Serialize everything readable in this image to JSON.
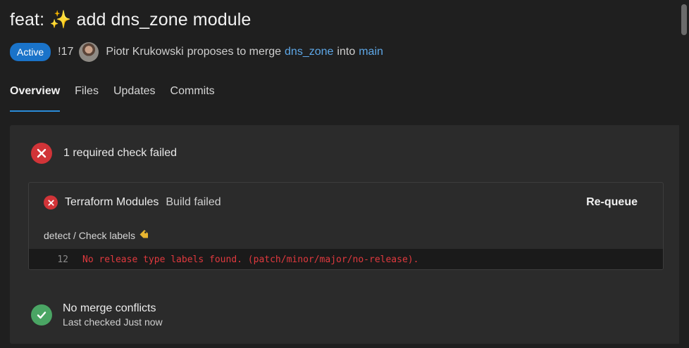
{
  "pr": {
    "title": "feat: ✨ add dns_zone module",
    "status": "Active",
    "id": "!17",
    "author": "Piotr Krukowski",
    "proposes_text": "proposes to merge",
    "source_branch": "dns_zone",
    "into_text": "into",
    "target_branch": "main"
  },
  "tabs": [
    {
      "label": "Overview",
      "active": true
    },
    {
      "label": "Files",
      "active": false
    },
    {
      "label": "Updates",
      "active": false
    },
    {
      "label": "Commits",
      "active": false
    }
  ],
  "checks": {
    "summary": "1 required check failed",
    "build": {
      "name": "Terraform Modules",
      "status": "Build failed",
      "action": "Re-queue",
      "job": "detect / Check labels",
      "log_line_number": "12",
      "log_text": "No release type labels found. (patch/minor/major/no-release)."
    }
  },
  "merge": {
    "title": "No merge conflicts",
    "subtitle": "Last checked Just now"
  },
  "colors": {
    "active_badge": "#1a73c9",
    "link": "#5ea8e8",
    "fail": "#d13438",
    "success": "#4aa564",
    "tab_underline": "#2a8bd8",
    "log_error": "#e0393e"
  }
}
